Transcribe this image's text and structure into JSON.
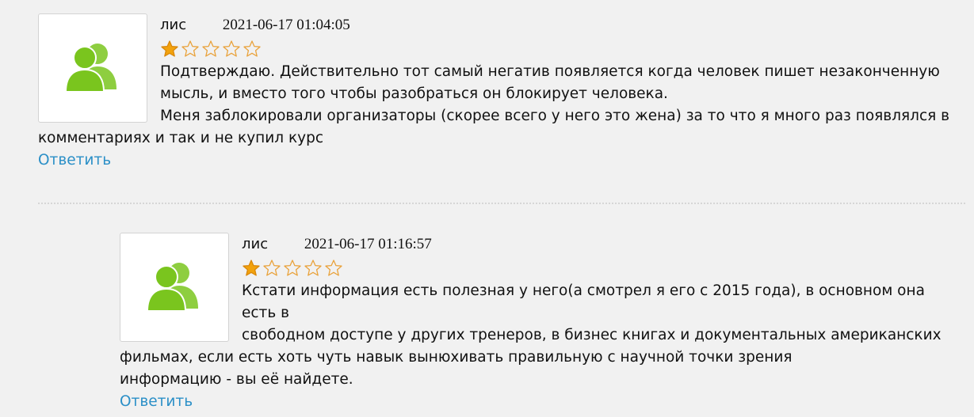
{
  "comments": [
    {
      "author": "лис",
      "date": "2021-06-17 01:04:05",
      "rating": 1,
      "text_line1": "Подтверждаю. Действительно тот самый негатив появляется когда человек пишет незаконченную",
      "text_line2": "мысль, и вместо того чтобы разобраться он блокирует человека.",
      "text_line3": "Меня заблокировали организаторы (скорее всего у него это жена) за то что я много раз появлялся в",
      "text_line4": "комментариях и так и не купил курс",
      "reply_label": "Ответить"
    },
    {
      "author": "лис",
      "date": "2021-06-17 01:16:57",
      "rating": 1,
      "text_line1": "Кстати информация есть полезная у него(а смотрел я его с 2015 года), в основном она есть в",
      "text_line2": "свободном доступе у других тренеров, в бизнес книгах и документальных американских",
      "text_line3": "фильмах, если есть хоть чуть навык вынюхивать правильную с научной точки зрения",
      "text_line4": "информацию - вы её найдете.",
      "reply_label": "Ответить"
    }
  ],
  "colors": {
    "avatar_icon": "#7ac51e",
    "star_filled": "#f2a20d",
    "star_empty_stroke": "#e9a23b",
    "link": "#2a8fc7"
  },
  "icons": {
    "avatar": "user-group-icon",
    "star": "star-icon"
  }
}
